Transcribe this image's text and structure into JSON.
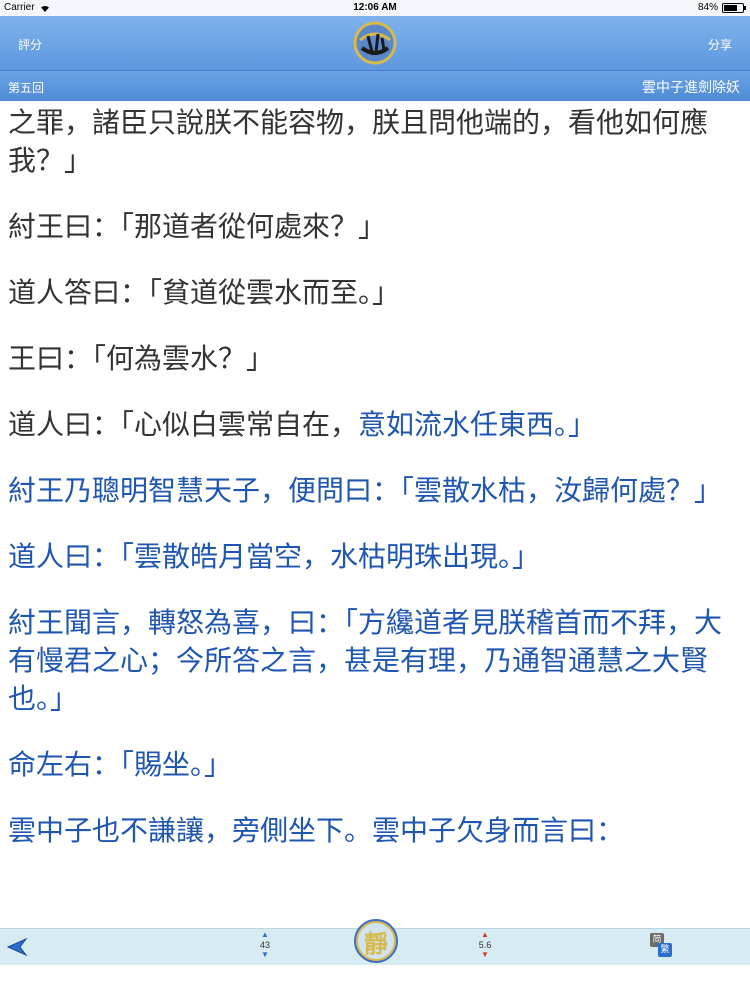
{
  "status": {
    "carrier": "Carrier",
    "time": "12:06 AM",
    "battery": "84%",
    "battery_level": 0.84
  },
  "nav": {
    "rate_label": "評分",
    "share_label": "分享",
    "logo_icon": "fengshen-logo"
  },
  "chapter": {
    "number": "第五回",
    "title": "雲中子進劍除妖"
  },
  "content": {
    "p1": "之罪，諸臣只說朕不能容物，朕且問他端的，看他如何應我？」",
    "p2": "紂王曰：「那道者從何處來？」",
    "p3": "道人答曰：「貧道從雲水而至。」",
    "p4": "王曰：「何為雲水？」",
    "p5_a": "道人曰：「心似白雲常自在，",
    "p5_b": "意如流水任東西。」",
    "p6": "紂王乃聰明智慧天子，便問曰：「雲散水枯，汝歸何處？」",
    "p7": "道人曰：「雲散皓月當空，水枯明珠出現。」",
    "p8": "紂王聞言，轉怒為喜，曰：「方纔道者見朕稽首而不拜，大有慢君之心；今所答之言，甚是有理，乃通智通慧之大賢也。」",
    "p9": "命左右：「賜坐。」",
    "p10": "雲中子也不謙讓，旁側坐下。雲中子欠身而言曰："
  },
  "toolbar": {
    "back_icon": "back-arrow-icon",
    "font_size_value": "43",
    "jing_label": "靜",
    "line_spacing_value": "5.6",
    "simp_label": "简",
    "trad_label": "繁"
  },
  "colors": {
    "navbar": "#6fa5e8",
    "highlight_text": "#1f56b0",
    "toolbar": "#d6ecf2"
  }
}
